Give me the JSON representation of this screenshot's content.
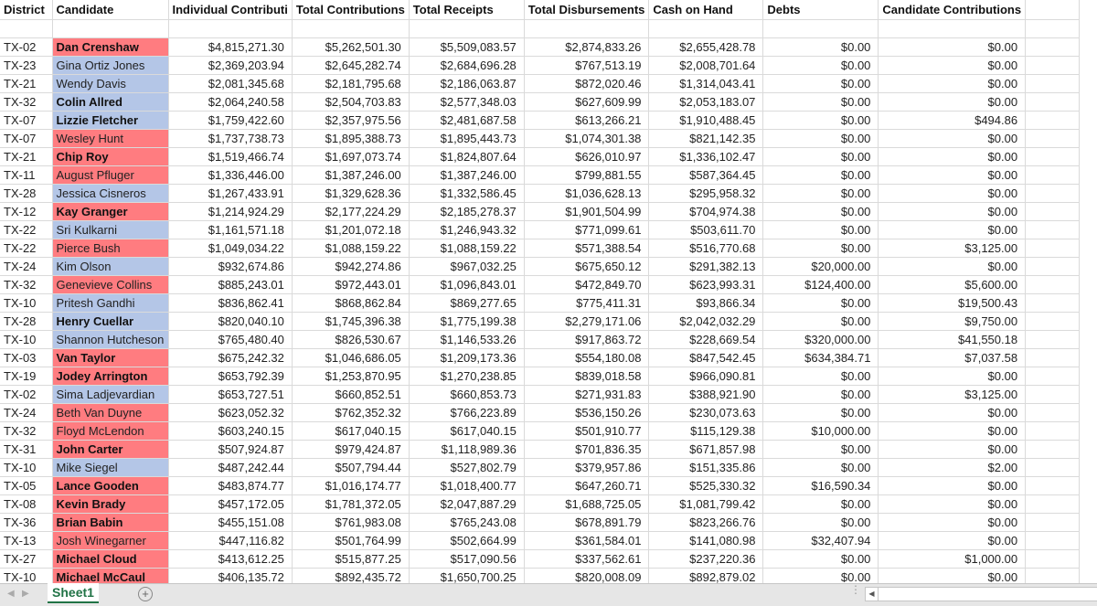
{
  "columns": [
    "District",
    "Candidate",
    "Individual Contributi",
    "Total Contributions",
    "Total Receipts",
    "Total Disbursements",
    "Cash on Hand",
    "Debts",
    "Candidate Contributions"
  ],
  "colors": {
    "republican": "#ff7c80",
    "democrat": "#b4c6e7",
    "sheet_tab_accent": "#217346"
  },
  "rows": [
    {
      "district": "TX-02",
      "candidate": "Dan Crenshaw",
      "party": "rep",
      "bold": true,
      "individual": "$4,815,271.30",
      "total_contributions": "$5,262,501.30",
      "total_receipts": "$5,509,083.57",
      "disbursements": "$2,874,833.26",
      "cash": "$2,655,428.78",
      "debts": "$0.00",
      "candidate_contributions": "$0.00"
    },
    {
      "district": "TX-23",
      "candidate": "Gina Ortiz Jones",
      "party": "dem",
      "bold": false,
      "individual": "$2,369,203.94",
      "total_contributions": "$2,645,282.74",
      "total_receipts": "$2,684,696.28",
      "disbursements": "$767,513.19",
      "cash": "$2,008,701.64",
      "debts": "$0.00",
      "candidate_contributions": "$0.00"
    },
    {
      "district": "TX-21",
      "candidate": "Wendy Davis",
      "party": "dem",
      "bold": false,
      "individual": "$2,081,345.68",
      "total_contributions": "$2,181,795.68",
      "total_receipts": "$2,186,063.87",
      "disbursements": "$872,020.46",
      "cash": "$1,314,043.41",
      "debts": "$0.00",
      "candidate_contributions": "$0.00"
    },
    {
      "district": "TX-32",
      "candidate": "Colin Allred",
      "party": "dem",
      "bold": true,
      "individual": "$2,064,240.58",
      "total_contributions": "$2,504,703.83",
      "total_receipts": "$2,577,348.03",
      "disbursements": "$627,609.99",
      "cash": "$2,053,183.07",
      "debts": "$0.00",
      "candidate_contributions": "$0.00"
    },
    {
      "district": "TX-07",
      "candidate": "Lizzie Fletcher",
      "party": "dem",
      "bold": true,
      "individual": "$1,759,422.60",
      "total_contributions": "$2,357,975.56",
      "total_receipts": "$2,481,687.58",
      "disbursements": "$613,266.21",
      "cash": "$1,910,488.45",
      "debts": "$0.00",
      "candidate_contributions": "$494.86"
    },
    {
      "district": "TX-07",
      "candidate": "Wesley Hunt",
      "party": "rep",
      "bold": false,
      "individual": "$1,737,738.73",
      "total_contributions": "$1,895,388.73",
      "total_receipts": "$1,895,443.73",
      "disbursements": "$1,074,301.38",
      "cash": "$821,142.35",
      "debts": "$0.00",
      "candidate_contributions": "$0.00"
    },
    {
      "district": "TX-21",
      "candidate": "Chip Roy",
      "party": "rep",
      "bold": true,
      "individual": "$1,519,466.74",
      "total_contributions": "$1,697,073.74",
      "total_receipts": "$1,824,807.64",
      "disbursements": "$626,010.97",
      "cash": "$1,336,102.47",
      "debts": "$0.00",
      "candidate_contributions": "$0.00"
    },
    {
      "district": "TX-11",
      "candidate": "August Pfluger",
      "party": "rep",
      "bold": false,
      "individual": "$1,336,446.00",
      "total_contributions": "$1,387,246.00",
      "total_receipts": "$1,387,246.00",
      "disbursements": "$799,881.55",
      "cash": "$587,364.45",
      "debts": "$0.00",
      "candidate_contributions": "$0.00"
    },
    {
      "district": "TX-28",
      "candidate": "Jessica Cisneros",
      "party": "dem",
      "bold": false,
      "individual": "$1,267,433.91",
      "total_contributions": "$1,329,628.36",
      "total_receipts": "$1,332,586.45",
      "disbursements": "$1,036,628.13",
      "cash": "$295,958.32",
      "debts": "$0.00",
      "candidate_contributions": "$0.00"
    },
    {
      "district": "TX-12",
      "candidate": "Kay Granger",
      "party": "rep",
      "bold": true,
      "individual": "$1,214,924.29",
      "total_contributions": "$2,177,224.29",
      "total_receipts": "$2,185,278.37",
      "disbursements": "$1,901,504.99",
      "cash": "$704,974.38",
      "debts": "$0.00",
      "candidate_contributions": "$0.00"
    },
    {
      "district": "TX-22",
      "candidate": "Sri Kulkarni",
      "party": "dem",
      "bold": false,
      "individual": "$1,161,571.18",
      "total_contributions": "$1,201,072.18",
      "total_receipts": "$1,246,943.32",
      "disbursements": "$771,099.61",
      "cash": "$503,611.70",
      "debts": "$0.00",
      "candidate_contributions": "$0.00"
    },
    {
      "district": "TX-22",
      "candidate": "Pierce Bush",
      "party": "rep",
      "bold": false,
      "individual": "$1,049,034.22",
      "total_contributions": "$1,088,159.22",
      "total_receipts": "$1,088,159.22",
      "disbursements": "$571,388.54",
      "cash": "$516,770.68",
      "debts": "$0.00",
      "candidate_contributions": "$3,125.00"
    },
    {
      "district": "TX-24",
      "candidate": "Kim Olson",
      "party": "dem",
      "bold": false,
      "individual": "$932,674.86",
      "total_contributions": "$942,274.86",
      "total_receipts": "$967,032.25",
      "disbursements": "$675,650.12",
      "cash": "$291,382.13",
      "debts": "$20,000.00",
      "candidate_contributions": "$0.00"
    },
    {
      "district": "TX-32",
      "candidate": "Genevieve Collins",
      "party": "rep",
      "bold": false,
      "individual": "$885,243.01",
      "total_contributions": "$972,443.01",
      "total_receipts": "$1,096,843.01",
      "disbursements": "$472,849.70",
      "cash": "$623,993.31",
      "debts": "$124,400.00",
      "candidate_contributions": "$5,600.00"
    },
    {
      "district": "TX-10",
      "candidate": "Pritesh Gandhi",
      "party": "dem",
      "bold": false,
      "individual": "$836,862.41",
      "total_contributions": "$868,862.84",
      "total_receipts": "$869,277.65",
      "disbursements": "$775,411.31",
      "cash": "$93,866.34",
      "debts": "$0.00",
      "candidate_contributions": "$19,500.43"
    },
    {
      "district": "TX-28",
      "candidate": "Henry Cuellar",
      "party": "dem",
      "bold": true,
      "individual": "$820,040.10",
      "total_contributions": "$1,745,396.38",
      "total_receipts": "$1,775,199.38",
      "disbursements": "$2,279,171.06",
      "cash": "$2,042,032.29",
      "debts": "$0.00",
      "candidate_contributions": "$9,750.00"
    },
    {
      "district": "TX-10",
      "candidate": "Shannon Hutcheson",
      "party": "dem",
      "bold": false,
      "individual": "$765,480.40",
      "total_contributions": "$826,530.67",
      "total_receipts": "$1,146,533.26",
      "disbursements": "$917,863.72",
      "cash": "$228,669.54",
      "debts": "$320,000.00",
      "candidate_contributions": "$41,550.18"
    },
    {
      "district": "TX-03",
      "candidate": "Van Taylor",
      "party": "rep",
      "bold": true,
      "individual": "$675,242.32",
      "total_contributions": "$1,046,686.05",
      "total_receipts": "$1,209,173.36",
      "disbursements": "$554,180.08",
      "cash": "$847,542.45",
      "debts": "$634,384.71",
      "candidate_contributions": "$7,037.58"
    },
    {
      "district": "TX-19",
      "candidate": "Jodey Arrington",
      "party": "rep",
      "bold": true,
      "individual": "$653,792.39",
      "total_contributions": "$1,253,870.95",
      "total_receipts": "$1,270,238.85",
      "disbursements": "$839,018.58",
      "cash": "$966,090.81",
      "debts": "$0.00",
      "candidate_contributions": "$0.00"
    },
    {
      "district": "TX-02",
      "candidate": "Sima Ladjevardian",
      "party": "dem",
      "bold": false,
      "individual": "$653,727.51",
      "total_contributions": "$660,852.51",
      "total_receipts": "$660,853.73",
      "disbursements": "$271,931.83",
      "cash": "$388,921.90",
      "debts": "$0.00",
      "candidate_contributions": "$3,125.00"
    },
    {
      "district": "TX-24",
      "candidate": "Beth Van Duyne",
      "party": "rep",
      "bold": false,
      "individual": "$623,052.32",
      "total_contributions": "$762,352.32",
      "total_receipts": "$766,223.89",
      "disbursements": "$536,150.26",
      "cash": "$230,073.63",
      "debts": "$0.00",
      "candidate_contributions": "$0.00"
    },
    {
      "district": "TX-32",
      "candidate": "Floyd McLendon",
      "party": "rep",
      "bold": false,
      "individual": "$603,240.15",
      "total_contributions": "$617,040.15",
      "total_receipts": "$617,040.15",
      "disbursements": "$501,910.77",
      "cash": "$115,129.38",
      "debts": "$10,000.00",
      "candidate_contributions": "$0.00"
    },
    {
      "district": "TX-31",
      "candidate": "John Carter",
      "party": "rep",
      "bold": true,
      "individual": "$507,924.87",
      "total_contributions": "$979,424.87",
      "total_receipts": "$1,118,989.36",
      "disbursements": "$701,836.35",
      "cash": "$671,857.98",
      "debts": "$0.00",
      "candidate_contributions": "$0.00"
    },
    {
      "district": "TX-10",
      "candidate": "Mike Siegel",
      "party": "dem",
      "bold": false,
      "individual": "$487,242.44",
      "total_contributions": "$507,794.44",
      "total_receipts": "$527,802.79",
      "disbursements": "$379,957.86",
      "cash": "$151,335.86",
      "debts": "$0.00",
      "candidate_contributions": "$2.00"
    },
    {
      "district": "TX-05",
      "candidate": "Lance Gooden",
      "party": "rep",
      "bold": true,
      "individual": "$483,874.77",
      "total_contributions": "$1,016,174.77",
      "total_receipts": "$1,018,400.77",
      "disbursements": "$647,260.71",
      "cash": "$525,330.32",
      "debts": "$16,590.34",
      "candidate_contributions": "$0.00"
    },
    {
      "district": "TX-08",
      "candidate": "Kevin Brady",
      "party": "rep",
      "bold": true,
      "individual": "$457,172.05",
      "total_contributions": "$1,781,372.05",
      "total_receipts": "$2,047,887.29",
      "disbursements": "$1,688,725.05",
      "cash": "$1,081,799.42",
      "debts": "$0.00",
      "candidate_contributions": "$0.00"
    },
    {
      "district": "TX-36",
      "candidate": "Brian Babin",
      "party": "rep",
      "bold": true,
      "individual": "$455,151.08",
      "total_contributions": "$761,983.08",
      "total_receipts": "$765,243.08",
      "disbursements": "$678,891.79",
      "cash": "$823,266.76",
      "debts": "$0.00",
      "candidate_contributions": "$0.00"
    },
    {
      "district": "TX-13",
      "candidate": "Josh Winegarner",
      "party": "rep",
      "bold": false,
      "individual": "$447,116.82",
      "total_contributions": "$501,764.99",
      "total_receipts": "$502,664.99",
      "disbursements": "$361,584.01",
      "cash": "$141,080.98",
      "debts": "$32,407.94",
      "candidate_contributions": "$0.00"
    },
    {
      "district": "TX-27",
      "candidate": "Michael Cloud",
      "party": "rep",
      "bold": true,
      "individual": "$413,612.25",
      "total_contributions": "$515,877.25",
      "total_receipts": "$517,090.56",
      "disbursements": "$337,562.61",
      "cash": "$237,220.36",
      "debts": "$0.00",
      "candidate_contributions": "$1,000.00"
    },
    {
      "district": "TX-10",
      "candidate": "Michael McCaul",
      "party": "rep",
      "bold": true,
      "individual": "$406,135.72",
      "total_contributions": "$892,435.72",
      "total_receipts": "$1,650,700.25",
      "disbursements": "$820,008.09",
      "cash": "$892,879.02",
      "debts": "$0.00",
      "candidate_contributions": "$0.00"
    }
  ],
  "footer": {
    "sheet_tabs": [
      "Sheet1"
    ],
    "add_sheet_icon": "plus-circle-icon",
    "nav_left_icon": "triangle-left-icon",
    "nav_right_icon": "triangle-right-icon",
    "add_sheet_glyph": "+",
    "nav_left_glyph": "◀",
    "nav_right_glyph": "▶",
    "dots_glyph": "⋮",
    "scroll_left_glyph": "◀"
  }
}
